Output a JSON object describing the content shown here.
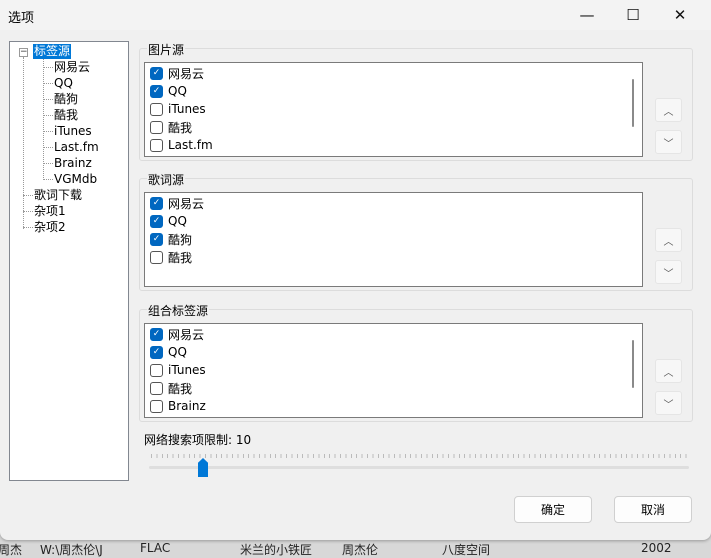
{
  "window": {
    "title": "选项",
    "minimize": "—",
    "maximize": "☐",
    "close": "✕"
  },
  "tree": {
    "root": "标签源",
    "children": [
      "网易云",
      "QQ",
      "酷狗",
      "酷我",
      "iTunes",
      "Last.fm",
      "Brainz",
      "VGMdb"
    ],
    "others": [
      "歌词下载",
      "杂项1",
      "杂项2"
    ],
    "expander": "−"
  },
  "groups": [
    {
      "label": "图片源",
      "items": [
        {
          "label": "网易云",
          "checked": true
        },
        {
          "label": "QQ",
          "checked": true
        },
        {
          "label": "iTunes",
          "checked": false
        },
        {
          "label": "酷我",
          "checked": false
        },
        {
          "label": "Last.fm",
          "checked": false
        }
      ]
    },
    {
      "label": "歌词源",
      "items": [
        {
          "label": "网易云",
          "checked": true
        },
        {
          "label": "QQ",
          "checked": true
        },
        {
          "label": "酷狗",
          "checked": true
        },
        {
          "label": "酷我",
          "checked": false
        }
      ]
    },
    {
      "label": "组合标签源",
      "items": [
        {
          "label": "网易云",
          "checked": true
        },
        {
          "label": "QQ",
          "checked": true
        },
        {
          "label": "iTunes",
          "checked": false
        },
        {
          "label": "酷我",
          "checked": false
        },
        {
          "label": "Brainz",
          "checked": false
        }
      ]
    }
  ],
  "arrows": {
    "up": "︿",
    "down": "﹀"
  },
  "slider": {
    "label": "网络搜索项限制: 10",
    "value": 10,
    "fraction": 0.1
  },
  "buttons": {
    "ok": "确定",
    "cancel": "取消"
  },
  "background_row": [
    "周杰",
    "W:\\周杰伦\\J",
    "FLAC",
    "米兰的小铁匠",
    "周杰伦",
    "八度空间",
    "2002"
  ],
  "colors": {
    "accent": "#0078d7",
    "check": "#0067c0"
  }
}
